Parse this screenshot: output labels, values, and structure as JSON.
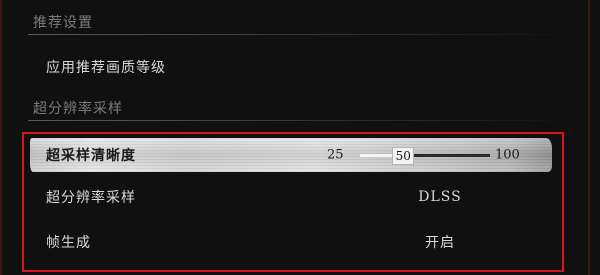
{
  "sections": {
    "recommend_title": "推荐设置",
    "upscale_title": "超分辨率采样"
  },
  "rows": {
    "apply_recommended": {
      "label": "应用推荐画质等级"
    },
    "render_scale": {
      "label": "超采样清晰度",
      "min": "25",
      "max": "100",
      "value": "50",
      "value_fraction": 0.333
    },
    "upscaling": {
      "label": "超分辨率采样",
      "value": "DLSS"
    },
    "frame_generation": {
      "label": "帧生成",
      "value": "开启"
    }
  },
  "colors": {
    "background": "#101010",
    "highlight_border": "#d6161d",
    "selected_row_bg": "#dcdcdc",
    "text": "#d8d8d8",
    "section_text": "#7a7a7a"
  }
}
